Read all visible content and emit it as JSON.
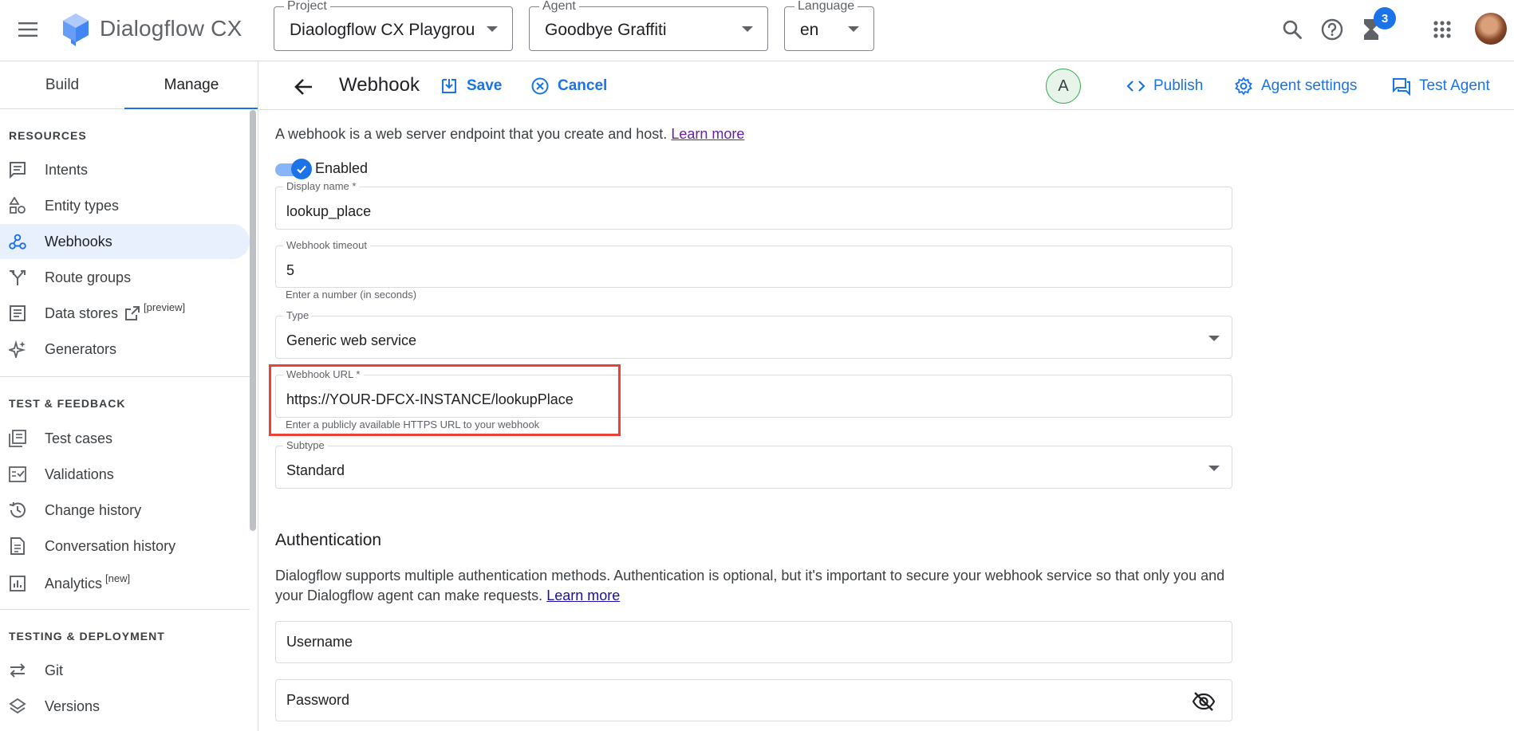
{
  "app": {
    "product_name": "Dialogflow CX",
    "project": {
      "label": "Project",
      "value": "Diaologflow CX Playgrou…"
    },
    "agent": {
      "label": "Agent",
      "value": "Goodbye Graffiti"
    },
    "language": {
      "label": "Language",
      "value": "en"
    },
    "notification_count": "3",
    "colors": {
      "accent": "#1a73e8",
      "highlight": "#ea4335",
      "active_nav_bg": "#e8f0fe"
    }
  },
  "sidebar": {
    "tabs": [
      {
        "label": "Build"
      },
      {
        "label": "Manage",
        "selected": true
      }
    ],
    "sections": [
      {
        "heading": "RESOURCES",
        "items": [
          {
            "label": "Intents",
            "icon": "intents-icon"
          },
          {
            "label": "Entity types",
            "icon": "entity-types-icon"
          },
          {
            "label": "Webhooks",
            "icon": "webhooks-icon",
            "active": true
          },
          {
            "label": "Route groups",
            "icon": "route-groups-icon"
          },
          {
            "label": "Data stores",
            "icon": "data-stores-icon",
            "suffix": "[preview]"
          },
          {
            "label": "Generators",
            "icon": "generators-icon"
          }
        ]
      },
      {
        "heading": "TEST & FEEDBACK",
        "items": [
          {
            "label": "Test cases",
            "icon": "test-cases-icon"
          },
          {
            "label": "Validations",
            "icon": "validations-icon"
          },
          {
            "label": "Change history",
            "icon": "change-history-icon"
          },
          {
            "label": "Conversation history",
            "icon": "conversation-history-icon"
          },
          {
            "label": "Analytics",
            "icon": "analytics-icon",
            "suffix": "[new]"
          }
        ]
      },
      {
        "heading": "TESTING & DEPLOYMENT",
        "items": [
          {
            "label": "Git",
            "icon": "git-icon"
          },
          {
            "label": "Versions",
            "icon": "versions-icon"
          }
        ]
      }
    ]
  },
  "header": {
    "title": "Webhook",
    "save": "Save",
    "cancel": "Cancel",
    "user_initial": "A",
    "publish": "Publish",
    "agent_settings": "Agent settings",
    "test_agent": "Test Agent"
  },
  "form": {
    "intro": "A webhook is a web server endpoint that you create and host.",
    "learn_more": "Learn more",
    "enabled_label": "Enabled",
    "enabled": true,
    "display_name": {
      "label": "Display name *",
      "value": "lookup_place"
    },
    "timeout": {
      "label": "Webhook timeout",
      "value": "5",
      "hint": "Enter a number (in seconds)"
    },
    "type": {
      "label": "Type",
      "value": "Generic web service"
    },
    "url": {
      "label": "Webhook URL *",
      "value": "https://YOUR-DFCX-INSTANCE/lookupPlace",
      "hint": "Enter a publicly available HTTPS URL to your webhook"
    },
    "subtype": {
      "label": "Subtype",
      "value": "Standard"
    }
  },
  "auth": {
    "title": "Authentication",
    "description": "Dialogflow supports multiple authentication methods. Authentication is optional, but it's important to secure your webhook service so that only you and your Dialogflow agent can make requests.",
    "learn_more": "Learn more",
    "username_placeholder": "Username",
    "password_placeholder": "Password"
  }
}
